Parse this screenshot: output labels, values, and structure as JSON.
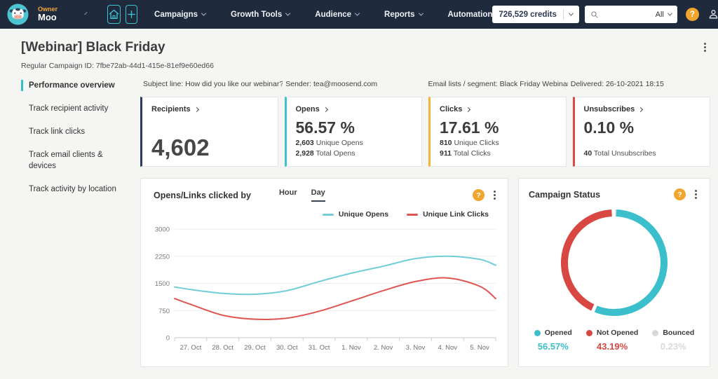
{
  "navbar": {
    "account": {
      "role": "Owner",
      "name": "Moo"
    },
    "items": [
      {
        "label": "Campaigns"
      },
      {
        "label": "Growth Tools"
      },
      {
        "label": "Audience"
      },
      {
        "label": "Reports"
      },
      {
        "label": "Automation"
      }
    ],
    "credits": "726,529 credits",
    "search": {
      "value": "",
      "filter": "All"
    },
    "help_glyph": "?"
  },
  "page": {
    "title": "[Webinar] Black Friday",
    "subtitle": "Regular Campaign ID: 7fbe72ab-44d1-415e-81ef9e60ed66"
  },
  "sidebar": {
    "items": [
      {
        "label": "Performance overview",
        "active": true
      },
      {
        "label": "Track recipient activity",
        "active": false
      },
      {
        "label": "Track link clicks",
        "active": false
      },
      {
        "label": "Track email clients & devices",
        "active": false
      },
      {
        "label": "Track activity by location",
        "active": false
      }
    ]
  },
  "info": {
    "subject": "Subject line: How did you like our webinar?",
    "sender": "Sender: tea@moosend.com",
    "lists": "Email lists / segment: Black Friday Webinar",
    "delivered": "Delivered: 26-10-2021 18:15"
  },
  "cards": [
    {
      "label": "Recipients",
      "accent": "#2c3c5c",
      "value": "4,602"
    },
    {
      "label": "Opens",
      "accent": "#3fc0ce",
      "value": "56.57 %",
      "stats": [
        {
          "num": "2,603",
          "text": "Unique Opens"
        },
        {
          "num": "2,928",
          "text": "Total Opens"
        }
      ]
    },
    {
      "label": "Clicks",
      "accent": "#f2b538",
      "value": "17.61 %",
      "stats": [
        {
          "num": "810",
          "text": "Unique Clicks"
        },
        {
          "num": "911",
          "text": "Total Clicks"
        }
      ]
    },
    {
      "label": "Unsubscribes",
      "accent": "#dd4a42",
      "value": "0.10 %",
      "stats": [
        {
          "num": "40",
          "text": "Total Unsubscribes"
        }
      ]
    }
  ],
  "chart_panel": {
    "title": "Opens/Links clicked by",
    "toggle": {
      "hour": "Hour",
      "day": "Day",
      "active": "Day"
    }
  },
  "campaign_panel": {
    "title": "Campaign Status"
  },
  "chart_data": [
    {
      "type": "line",
      "title": "Opens/Links clicked by Day",
      "x": [
        "27. Oct",
        "28. Oct",
        "29. Oct",
        "30. Oct",
        "31. Oct",
        "1. Nov",
        "2. Nov",
        "3. Nov",
        "4. Nov",
        "5. Nov"
      ],
      "ylim": [
        0,
        3000
      ],
      "yticks": [
        0,
        750,
        1500,
        2250,
        3000
      ],
      "grid": true,
      "legend_position": "top-right",
      "series": [
        {
          "name": "Unique Opens",
          "color": "#72cdd8",
          "edge_start": 1400,
          "values": [
            1330,
            1225,
            1200,
            1300,
            1550,
            1780,
            1975,
            2185,
            2250,
            2165
          ],
          "edge_end": 2000
        },
        {
          "name": "Unique Link Clicks",
          "color": "#e05551",
          "edge_start": 1080,
          "values": [
            920,
            620,
            510,
            540,
            730,
            1010,
            1300,
            1550,
            1650,
            1420
          ],
          "edge_end": 1080
        }
      ]
    },
    {
      "type": "donut",
      "title": "Campaign Status",
      "slices": [
        {
          "label": "Opened",
          "value": 56.57,
          "display": "56.57%",
          "color": "#3cbfcc"
        },
        {
          "label": "Not Opened",
          "value": 43.19,
          "display": "43.19%",
          "color": "#d94742"
        },
        {
          "label": "Bounced",
          "value": 0.23,
          "display": "0.23%",
          "color": "#d9d9d9"
        }
      ]
    }
  ]
}
